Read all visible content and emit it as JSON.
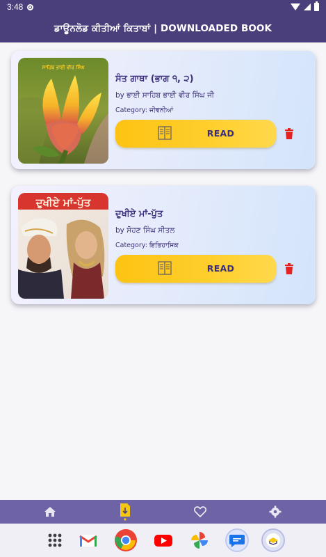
{
  "status_bar": {
    "time": "3:48"
  },
  "app_bar": {
    "title": "ਡਾਊਨਲੋਡ ਕੀਤੀਆਂ ਕਿਤਾਬਾਂ | DOWNLOADED BOOK"
  },
  "books": [
    {
      "title": "ਸੰਤ ਗਾਥਾ (ਭਾਗ ੧, ੨)",
      "author": "by ਭਾਈ ਸਾਹਿਬ ਭਾਈ ਵੀਰ ਸਿੰਘ ਜੀ",
      "category": "Category: ਜੀਵਨੀਆਂ",
      "read_label": "READ",
      "cover_text": "ਸਾਹਿਬ ਭਾਈ ਵੀਰ ਸਿੰਘ"
    },
    {
      "title": "ਦੁਖੀਏ ਮਾਂ-ਪੁੱਤ",
      "author": "by ਸੋਹਣ ਸਿੰਘ ਸੀਤਲ",
      "category": "Category: ਇਤਿਹਾਸਿਕ",
      "read_label": "READ",
      "cover_text": "ਦੁਖੀਏ ਮਾਂ-ਪੁੱਤ"
    }
  ],
  "bottom_nav": {
    "items": [
      "home-icon",
      "downloads-icon",
      "favorite-icon",
      "settings-icon"
    ],
    "active": "downloads-icon"
  },
  "dock": {
    "apps": [
      "apps-grid-icon",
      "gmail-icon",
      "chrome-icon",
      "youtube-icon",
      "photos-icon",
      "messages-icon",
      "app-icon"
    ]
  },
  "colors": {
    "primary": "#4a3f7b",
    "button": "#fdc313",
    "delete": "#e52222",
    "nav_active": "#f6c615"
  }
}
